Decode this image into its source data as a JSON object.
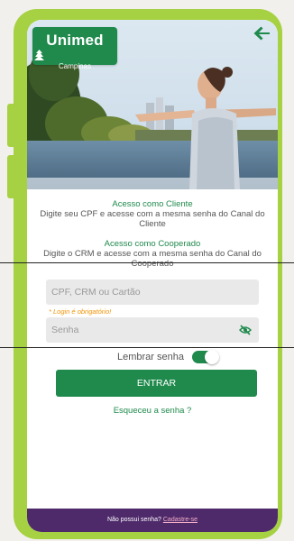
{
  "brand": {
    "name": "Unimed",
    "subtitle": "Campinas"
  },
  "client_section": {
    "title": "Acesso como Cliente",
    "description": "Digite seu CPF e acesse com a mesma senha do Canal do Cliente"
  },
  "coop_section": {
    "title": "Acesso como Cooperado",
    "description": "Digite o CRM e acesse com a mesma senha do Canal do Cooperado"
  },
  "login": {
    "placeholder": "CPF, CRM ou Cartão",
    "error": "* Login é obrigatório!"
  },
  "password": {
    "placeholder": "Senha"
  },
  "remember": {
    "label": "Lembrar senha",
    "enabled": true
  },
  "buttons": {
    "enter": "ENTRAR"
  },
  "forgot_link": "Esqueceu a senha ?",
  "footer": {
    "prompt": "Não possui senha?",
    "link": "Cadastre-se"
  },
  "colors": {
    "primary": "#1f8a4c",
    "frame": "#a6d142",
    "footer": "#4e2a6b",
    "error": "#f39200"
  },
  "icons": {
    "back": "arrow-left-icon",
    "password_toggle": "eye-off-icon",
    "logo": "unimed-tree-icon"
  }
}
